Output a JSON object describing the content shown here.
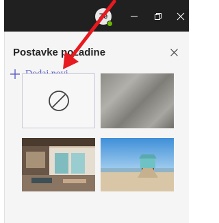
{
  "titlebar": {
    "avatar_initials": "Ze",
    "presence_color": "#6bb700",
    "controls": [
      "minimize-icon",
      "maximize-icon",
      "close-icon"
    ]
  },
  "panel": {
    "title": "Postavke pozadine",
    "close_icon": "close-icon",
    "add_new_label": "Dodaj novi",
    "add_icon": "plus-icon",
    "accent_color": "#5b5fc7"
  },
  "thumbnails": [
    {
      "kind": "none",
      "icon": "no-background-icon",
      "selected": true
    },
    {
      "kind": "blur"
    },
    {
      "kind": "office-image"
    },
    {
      "kind": "beach-image"
    }
  ],
  "annotation": {
    "icon": "red-arrow-icon",
    "color": "#e8191f"
  }
}
